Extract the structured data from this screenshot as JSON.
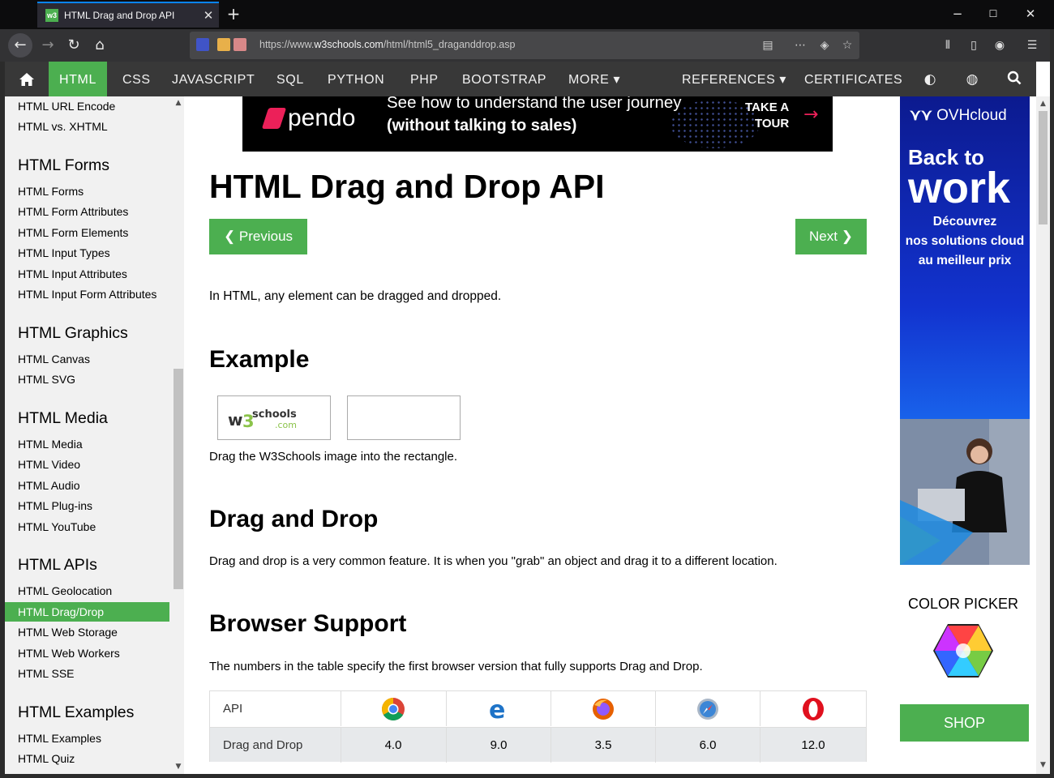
{
  "browser": {
    "tab_title": "HTML Drag and Drop API",
    "tab_favicon": "w3",
    "new_tab": "+",
    "url_prefix": "https://www.",
    "url_host": "w3schools.com",
    "url_path": "/html/html5_draganddrop.asp",
    "min": "−",
    "max": "☐",
    "close": "✕"
  },
  "w3nav": {
    "items": [
      "HTML",
      "CSS",
      "JAVASCRIPT",
      "SQL",
      "PYTHON",
      "PHP",
      "BOOTSTRAP",
      "MORE ▾",
      "REFERENCES ▾",
      "CERTIFICATES"
    ],
    "active": "HTML"
  },
  "sidebar": {
    "top_links": [
      "HTML URL Encode",
      "HTML vs. XHTML"
    ],
    "sections": [
      {
        "heading": "HTML Forms",
        "links": [
          "HTML Forms",
          "HTML Form Attributes",
          "HTML Form Elements",
          "HTML Input Types",
          "HTML Input Attributes",
          "HTML Input Form Attributes"
        ]
      },
      {
        "heading": "HTML Graphics",
        "links": [
          "HTML Canvas",
          "HTML SVG"
        ]
      },
      {
        "heading": "HTML Media",
        "links": [
          "HTML Media",
          "HTML Video",
          "HTML Audio",
          "HTML Plug-ins",
          "HTML YouTube"
        ]
      },
      {
        "heading": "HTML APIs",
        "links": [
          "HTML Geolocation",
          "HTML Drag/Drop",
          "HTML Web Storage",
          "HTML Web Workers",
          "HTML SSE"
        ]
      },
      {
        "heading": "HTML Examples",
        "links": [
          "HTML Examples",
          "HTML Quiz"
        ]
      }
    ],
    "active_link": "HTML Drag/Drop"
  },
  "ad_banner": {
    "brand": "pendo",
    "line1": "See how to understand the user journey",
    "line2": "(without talking to sales)",
    "cta1": "TAKE A",
    "cta2": "TOUR"
  },
  "main": {
    "title": "HTML Drag and Drop API",
    "prev_label": "❮ Previous",
    "next_label": "Next ❯",
    "intro": "In HTML, any element can be dragged and dropped.",
    "example_heading": "Example",
    "example_caption": "Drag the W3Schools image into the rectangle.",
    "dd_heading": "Drag and Drop",
    "dd_text": "Drag and drop is a very common feature. It is when you \"grab\" an object and drag it to a different location.",
    "support_heading": "Browser Support",
    "support_text": "The numbers in the table specify the first browser version that fully supports Drag and Drop.",
    "table": {
      "header_first": "API",
      "browsers": [
        "chrome-icon",
        "edge-icon",
        "firefox-icon",
        "safari-icon",
        "opera-icon"
      ],
      "row_label": "Drag and Drop",
      "versions": [
        "4.0",
        "9.0",
        "3.5",
        "6.0",
        "12.0"
      ]
    }
  },
  "right_ad": {
    "logo": "OVHcloud",
    "line1": "Back to",
    "line2": "work",
    "sub1": "Découvrez",
    "sub2": "nos solutions cloud",
    "sub3": "au meilleur prix"
  },
  "color_picker": {
    "title": "COLOR PICKER"
  },
  "shop": {
    "label": "SHOP"
  },
  "colors": {
    "w3_green": "#4caf50",
    "nav_dark": "#383838",
    "pendo_pink": "#ec2059",
    "ovh_blue": "#1233cf"
  }
}
